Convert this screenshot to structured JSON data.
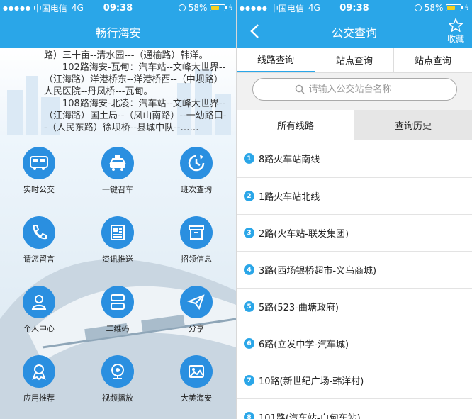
{
  "status_left": {
    "carrier": "中国电信",
    "network": "4G",
    "time": "09:38",
    "battery": "58%",
    "battery_level": 0.58
  },
  "status_right": {
    "carrier": "中国电信",
    "network": "4G",
    "time": "09:38",
    "battery": "58%",
    "battery_level": 0.58
  },
  "left_app": {
    "title": "畅行海安",
    "news": [
      "……（凤山南路）--一幼路口--（江海东路）三十亩--清水园---（通榆路）韩洋。",
      "102路海安-瓦甸：汽车站--文峰大世界--（江海路）洋港桥东--洋港桥西--（中坝路）人民医院--丹凤桥---瓦甸。",
      "108路海安-北凌：汽车站--文峰大世界--（江海路）国土局--（凤山南路）--一幼路口--（人民东路）徐坝桥--县城中队--……"
    ],
    "tiles": [
      {
        "label": "实时公交",
        "icon": "bus-icon"
      },
      {
        "label": "一键召车",
        "icon": "taxi-icon"
      },
      {
        "label": "班次查询",
        "icon": "schedule-clock-icon"
      },
      {
        "label": "请您留言",
        "icon": "phone-icon"
      },
      {
        "label": "资讯推送",
        "icon": "newspaper-icon"
      },
      {
        "label": "招领信息",
        "icon": "box-icon"
      },
      {
        "label": "个人中心",
        "icon": "user-icon"
      },
      {
        "label": "二维码",
        "icon": "qrcode-icon"
      },
      {
        "label": "分享",
        "icon": "paper-plane-icon"
      },
      {
        "label": "应用推荐",
        "icon": "badge-icon"
      },
      {
        "label": "视频播放",
        "icon": "camera-icon"
      },
      {
        "label": "大美海安",
        "icon": "picture-icon"
      }
    ]
  },
  "right_app": {
    "title": "公交查询",
    "favorite_label": "收藏",
    "tabs": [
      "线路查询",
      "站点查询",
      "站点查询"
    ],
    "search_placeholder": "请输入公交站台名称",
    "subtabs": [
      "所有线路",
      "查询历史"
    ],
    "routes": [
      {
        "num": "1",
        "name": "8路火车站南线"
      },
      {
        "num": "2",
        "name": "1路火车站北线"
      },
      {
        "num": "3",
        "name": "2路(火车站-联发集团)"
      },
      {
        "num": "4",
        "name": "3路(西场银桥超市-义乌商城)"
      },
      {
        "num": "5",
        "name": "5路(523-曲塘政府)"
      },
      {
        "num": "6",
        "name": "6路(立发中学-汽车城)"
      },
      {
        "num": "7",
        "name": "10路(新世纪广场-韩洋村)"
      },
      {
        "num": "8",
        "name": "101路(汽车站-白甸车站)"
      }
    ]
  },
  "colors": {
    "primary": "#2aa6e8",
    "tile_circle": "#2a8fe0"
  }
}
